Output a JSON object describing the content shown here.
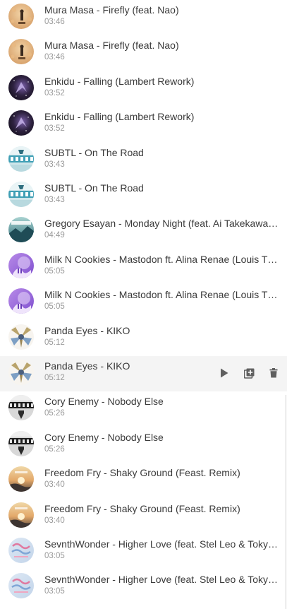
{
  "tracks": [
    {
      "title": "Mura Masa - Firefly (feat. Nao)",
      "duration": "03:46",
      "art": "mura-masa-firefly-art"
    },
    {
      "title": "Mura Masa - Firefly (feat. Nao)",
      "duration": "03:46",
      "art": "mura-masa-firefly-art"
    },
    {
      "title": "Enkidu - Falling (Lambert Rework)",
      "duration": "03:52",
      "art": "enkidu-falling-art"
    },
    {
      "title": "Enkidu - Falling (Lambert Rework)",
      "duration": "03:52",
      "art": "enkidu-falling-art"
    },
    {
      "title": "SUBTL - On The Road",
      "duration": "03:43",
      "art": "subtl-on-the-road-art"
    },
    {
      "title": "SUBTL - On The Road",
      "duration": "03:43",
      "art": "subtl-on-the-road-art"
    },
    {
      "title": "Gregory Esayan - Monday Night (feat. Ai Takekawa) (V...",
      "duration": "04:49",
      "art": "gregory-esayan-monday-night-art"
    },
    {
      "title": "Milk N Cookies - Mastodon ft. Alina Renae (Louis The ...",
      "duration": "05:05",
      "art": "milk-n-cookies-mastodon-art"
    },
    {
      "title": "Milk N Cookies - Mastodon ft. Alina Renae (Louis The ...",
      "duration": "05:05",
      "art": "milk-n-cookies-mastodon-art"
    },
    {
      "title": "Panda Eyes - KIKO",
      "duration": "05:12",
      "art": "panda-eyes-kiko-art"
    },
    {
      "title": "Panda Eyes - KIKO",
      "duration": "05:12",
      "art": "panda-eyes-kiko-art",
      "hovered": true
    },
    {
      "title": "Cory Enemy - Nobody Else",
      "duration": "05:26",
      "art": "cory-enemy-nobody-else-art"
    },
    {
      "title": "Cory Enemy - Nobody Else",
      "duration": "05:26",
      "art": "cory-enemy-nobody-else-art"
    },
    {
      "title": "Freedom Fry - Shaky Ground (Feast. Remix)",
      "duration": "03:40",
      "art": "freedom-fry-shaky-ground-art"
    },
    {
      "title": "Freedom Fry - Shaky Ground (Feast. Remix)",
      "duration": "03:40",
      "art": "freedom-fry-shaky-ground-art"
    },
    {
      "title": "SevnthWonder - Higher Love (feat. Stel Leo & Tokyo M...",
      "duration": "03:05",
      "art": "sevnthwonder-higher-love-art"
    },
    {
      "title": "SevnthWonder - Higher Love (feat. Stel Leo & Tokyo M...",
      "duration": "03:05",
      "art": "sevnthwonder-higher-love-art"
    }
  ],
  "row_actions": [
    {
      "icon": "play-icon",
      "label": "Play"
    },
    {
      "icon": "add-to-playlist-icon",
      "label": "Add to playlist"
    },
    {
      "icon": "trash-icon",
      "label": "Delete"
    }
  ],
  "colors": {
    "title_text": "#3a3a3a",
    "duration_text": "#9a9a9a",
    "hover_background": "#f4f4f4",
    "action_icon": "#5f5f5f"
  }
}
